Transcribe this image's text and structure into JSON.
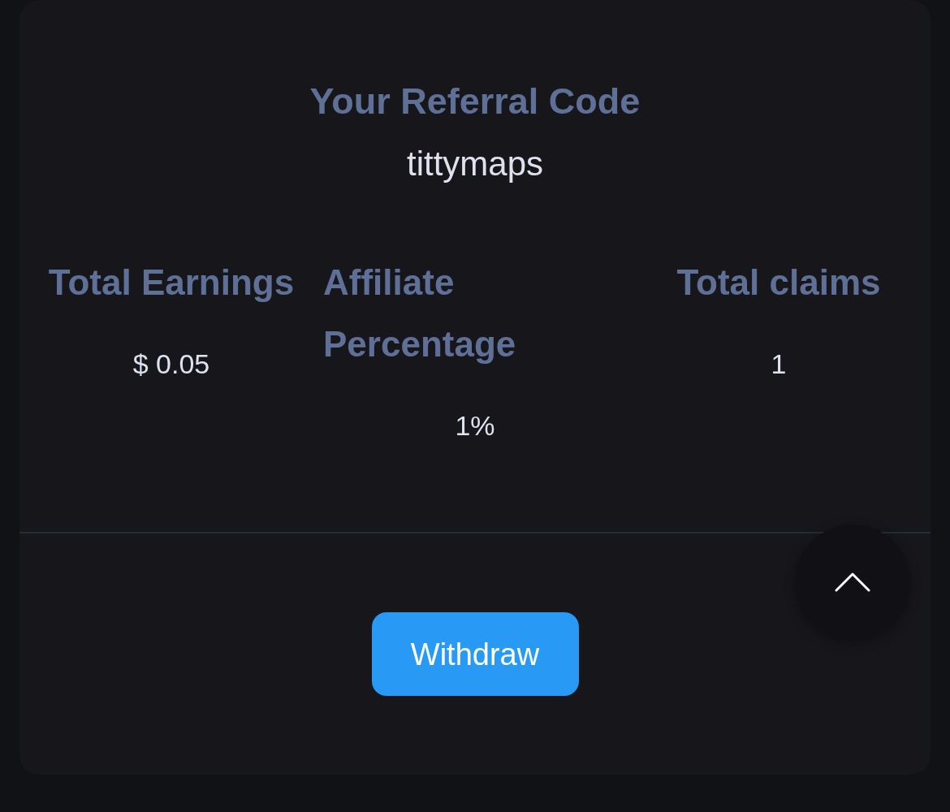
{
  "referral": {
    "title": "Your Referral Code",
    "code": "tittymaps"
  },
  "stats": [
    {
      "label": "Total Earnings",
      "value": "$ 0.05"
    },
    {
      "label": "Affiliate Percentage",
      "value": "1%"
    },
    {
      "label": "Total claims",
      "value": "1"
    }
  ],
  "withdraw_button": {
    "label": "Withdraw"
  }
}
